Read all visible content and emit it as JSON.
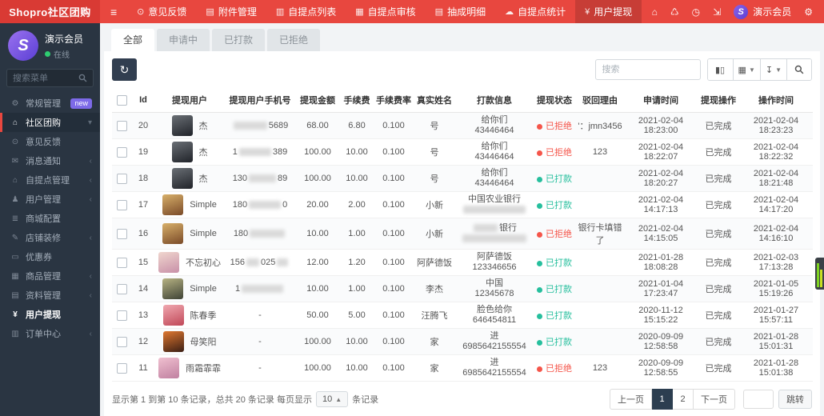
{
  "colors": {
    "accent": "#e8473f",
    "navy": "#2c3e50",
    "badge": "#7d6ae8",
    "status_rejected": "#f5554a",
    "status_paid": "#26bf9d",
    "online": "#2ecc71"
  },
  "topbar": {
    "brand": "Shopro社区团购",
    "menu": [
      {
        "key": "feedback",
        "label": "意见反馈",
        "icon": "info-circle-icon"
      },
      {
        "key": "files",
        "label": "附件管理",
        "icon": "file-icon"
      },
      {
        "key": "list",
        "label": "自提点列表",
        "icon": "list-icon"
      },
      {
        "key": "audit",
        "label": "自提点审核",
        "icon": "audit-icon"
      },
      {
        "key": "detail",
        "label": "抽成明细",
        "icon": "detail-icon"
      },
      {
        "key": "stats",
        "label": "自提点统计",
        "icon": "cloud-icon"
      },
      {
        "key": "withdraw",
        "label": "用户提现",
        "icon": "yen-icon",
        "active": true
      }
    ],
    "user_name": "演示会员"
  },
  "sidebar": {
    "profile": {
      "name": "演示会员",
      "status": "在线",
      "logo_letter": "S"
    },
    "search_placeholder": "搜索菜单",
    "items": [
      {
        "key": "general",
        "label": "常规管理",
        "icon": "gear-icon",
        "badge": "new"
      },
      {
        "key": "community",
        "label": "社区团购",
        "icon": "home-icon",
        "parent_active": true,
        "chevron": "down"
      },
      {
        "key": "feedback",
        "label": "意见反馈",
        "icon": "info-circle-icon"
      },
      {
        "key": "notice",
        "label": "消息通知",
        "icon": "message-icon",
        "chevron": "left"
      },
      {
        "key": "station",
        "label": "自提点管理",
        "icon": "store-icon",
        "chevron": "left"
      },
      {
        "key": "users",
        "label": "用户管理",
        "icon": "user-icon",
        "chevron": "left"
      },
      {
        "key": "config",
        "label": "商城配置",
        "icon": "config-icon"
      },
      {
        "key": "decorate",
        "label": "店铺装修",
        "icon": "pencil-icon",
        "chevron": "left"
      },
      {
        "key": "coupon",
        "label": "优惠券",
        "icon": "coupon-icon"
      },
      {
        "key": "goods",
        "label": "商品管理",
        "icon": "goods-icon",
        "chevron": "left"
      },
      {
        "key": "material",
        "label": "资料管理",
        "icon": "docs-icon",
        "chevron": "left"
      },
      {
        "key": "withdraw",
        "label": "用户提现",
        "icon": "yen-icon",
        "selected": true
      },
      {
        "key": "orders",
        "label": "订单中心",
        "icon": "order-icon",
        "chevron": "left"
      }
    ]
  },
  "tabs": {
    "items": [
      "全部",
      "申请中",
      "已打款",
      "已拒绝"
    ],
    "active_index": 0
  },
  "toolbar": {
    "search_placeholder": "搜索"
  },
  "table": {
    "columns": [
      "Id",
      "提现用户",
      "提现用户手机号",
      "提现金额",
      "手续费",
      "手续费率",
      "真实姓名",
      "打款信息",
      "提现状态",
      "驳回理由",
      "申请时间",
      "提现操作",
      "操作时间"
    ],
    "rows": [
      {
        "id": "20",
        "user": "杰",
        "avatar": [
          "#6a6f75",
          "#202329"
        ],
        "phone": {
          "pre": "",
          "blur": 42,
          "suf": "5689"
        },
        "amount": "68.00",
        "fee": "6.80",
        "rate": "0.100",
        "real": "号",
        "pay": [
          {
            "text": "给你们"
          },
          {
            "text": "43446464"
          }
        ],
        "status": "rejected",
        "reason": "'：jmn3456",
        "apply": "2021-02-04 18:23:00",
        "op": "已完成",
        "optime": "2021-02-04 18:23:23"
      },
      {
        "id": "19",
        "user": "杰",
        "avatar": [
          "#6a6f75",
          "#202329"
        ],
        "phone": {
          "pre": "1",
          "blur": 40,
          "suf": "389"
        },
        "amount": "100.00",
        "fee": "10.00",
        "rate": "0.100",
        "real": "号",
        "pay": [
          {
            "text": "给你们"
          },
          {
            "text": "43446464"
          }
        ],
        "status": "rejected",
        "reason": "123",
        "apply": "2021-02-04 18:22:07",
        "op": "已完成",
        "optime": "2021-02-04 18:22:32"
      },
      {
        "id": "18",
        "user": "杰",
        "avatar": [
          "#6a6f75",
          "#202329"
        ],
        "phone": {
          "pre": "130",
          "blur": 34,
          "suf": "89"
        },
        "amount": "100.00",
        "fee": "10.00",
        "rate": "0.100",
        "real": "号",
        "pay": [
          {
            "text": "给你们"
          },
          {
            "text": "43446464"
          }
        ],
        "status": "paid",
        "reason": "",
        "apply": "2021-02-04 18:20:27",
        "op": "已完成",
        "optime": "2021-02-04 18:21:48"
      },
      {
        "id": "17",
        "user": "Simple",
        "avatar": [
          "#d8b06a",
          "#7a4a28"
        ],
        "phone": {
          "pre": "180",
          "blur": 40,
          "suf": "0"
        },
        "amount": "20.00",
        "fee": "2.00",
        "rate": "0.100",
        "real": "小新",
        "pay": [
          {
            "text": "中国农业银行"
          },
          {
            "blur": 78
          }
        ],
        "status": "paid",
        "reason": "",
        "apply": "2021-02-04 14:17:13",
        "op": "已完成",
        "optime": "2021-02-04 14:17:20"
      },
      {
        "id": "16",
        "user": "Simple",
        "avatar": [
          "#d8b06a",
          "#7a4a28"
        ],
        "phone": {
          "pre": "180",
          "blur": 44,
          "suf": ""
        },
        "amount": "10.00",
        "fee": "1.00",
        "rate": "0.100",
        "real": "小新",
        "pay": [
          {
            "blur": 30,
            "text": "银行"
          },
          {
            "blur": 80
          }
        ],
        "status": "rejected",
        "reason": "银行卡填错了",
        "apply": "2021-02-04 14:15:05",
        "op": "已完成",
        "optime": "2021-02-04 14:16:10"
      },
      {
        "id": "15",
        "user": "不忘初心",
        "avatar": [
          "#f0d6ce",
          "#c890a8"
        ],
        "phone": {
          "pre": "156",
          "blur": 16,
          "suf": "025",
          "blur2": 14
        },
        "amount": "12.00",
        "fee": "1.20",
        "rate": "0.100",
        "real": "阿萨德饭",
        "pay": [
          {
            "text": "阿萨德饭"
          },
          {
            "text": "123346656"
          }
        ],
        "status": "paid",
        "reason": "",
        "apply": "2021-01-28 18:08:28",
        "op": "已完成",
        "optime": "2021-02-03 17:13:28"
      },
      {
        "id": "14",
        "user": "Simple",
        "avatar": [
          "#b7b383",
          "#3f4336"
        ],
        "phone": {
          "pre": "1",
          "blur": 52,
          "suf": ""
        },
        "amount": "10.00",
        "fee": "1.00",
        "rate": "0.100",
        "real": "李杰",
        "pay": [
          {
            "text": "中国"
          },
          {
            "text": "12345678"
          }
        ],
        "status": "paid",
        "reason": "",
        "apply": "2021-01-04 17:23:47",
        "op": "已完成",
        "optime": "2021-01-05 15:19:26"
      },
      {
        "id": "13",
        "user": "陈春季",
        "avatar": [
          "#f0a8b0",
          "#c04858"
        ],
        "phone": {
          "pre": "-",
          "blur": 0,
          "suf": ""
        },
        "amount": "50.00",
        "fee": "5.00",
        "rate": "0.100",
        "real": "汪腾飞",
        "pay": [
          {
            "text": "脸色给你"
          },
          {
            "text": "646454811"
          }
        ],
        "status": "paid",
        "reason": "",
        "apply": "2020-11-12 15:15:22",
        "op": "已完成",
        "optime": "2021-01-27 15:57:11"
      },
      {
        "id": "12",
        "user": "母笑阳",
        "avatar": [
          "#e07830",
          "#3a1e14"
        ],
        "phone": {
          "pre": "-",
          "blur": 0,
          "suf": ""
        },
        "amount": "100.00",
        "fee": "10.00",
        "rate": "0.100",
        "real": "家",
        "pay": [
          {
            "text": "进"
          },
          {
            "text": "6985642155554"
          }
        ],
        "status": "paid",
        "reason": "",
        "apply": "2020-09-09 12:58:58",
        "op": "已完成",
        "optime": "2021-01-28 15:01:31"
      },
      {
        "id": "11",
        "user": "雨霜霏霏",
        "avatar": [
          "#f0c0d0",
          "#c080a0"
        ],
        "phone": {
          "pre": "-",
          "blur": 0,
          "suf": ""
        },
        "amount": "100.00",
        "fee": "10.00",
        "rate": "0.100",
        "real": "家",
        "pay": [
          {
            "text": "进"
          },
          {
            "text": "6985642155554"
          }
        ],
        "status": "rejected",
        "reason": "123",
        "apply": "2020-09-09 12:58:55",
        "op": "已完成",
        "optime": "2021-01-28 15:01:38"
      }
    ],
    "status_labels": {
      "rejected": "已拒绝",
      "paid": "已打款"
    }
  },
  "footer": {
    "summary_pre": "显示第 1 到第 10 条记录，总共 20 条记录 每页显示",
    "per_page": "10",
    "summary_post": "条记录",
    "prev_label": "上一页",
    "pages": [
      "1",
      "2"
    ],
    "active_page": "1",
    "next_label": "下一页",
    "jump_label": "跳转"
  }
}
